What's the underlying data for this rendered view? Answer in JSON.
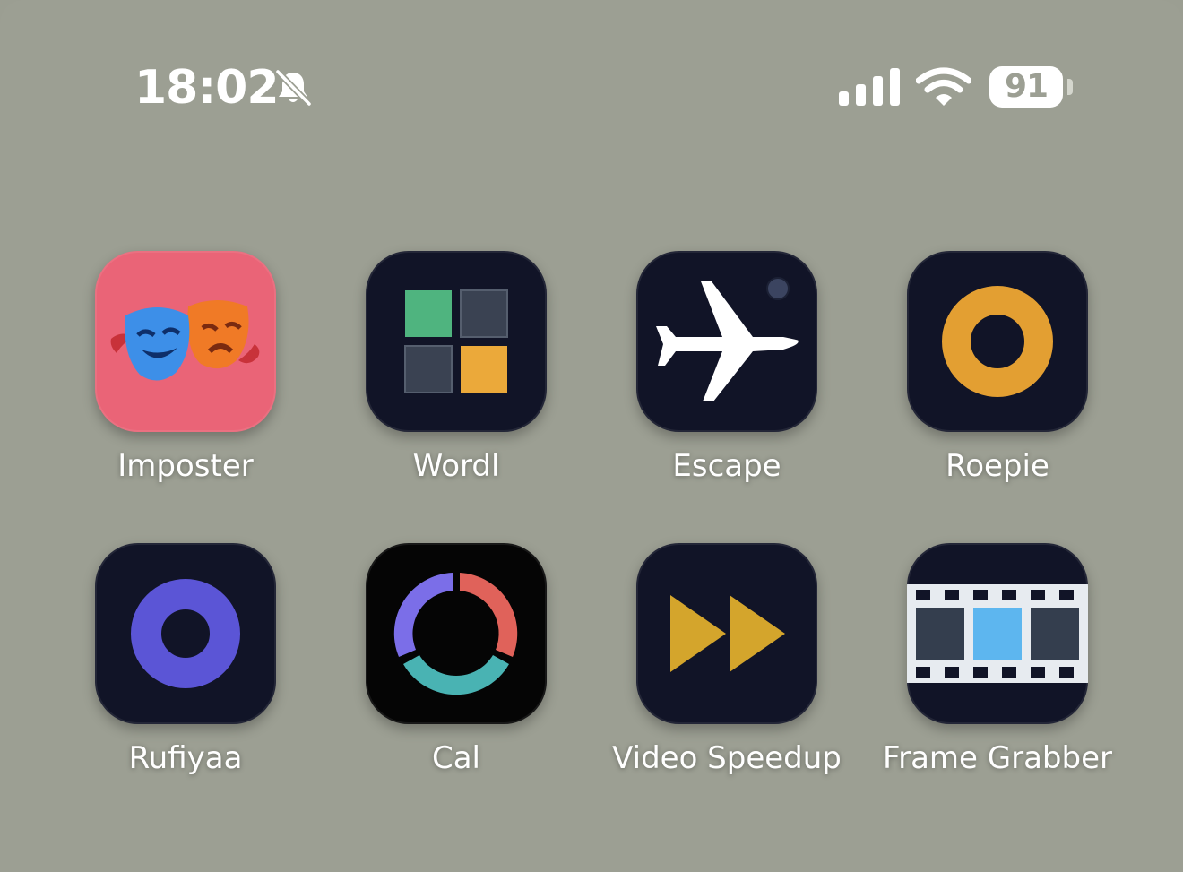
{
  "status_bar": {
    "time": "18:02",
    "silent_icon": "bell-slash-icon",
    "signal_icon": "cellular-signal-icon",
    "wifi_icon": "wifi-icon",
    "battery_level": "91"
  },
  "apps": [
    {
      "label": "Imposter",
      "icon": "theater-masks-icon",
      "color": "#ea6477"
    },
    {
      "label": "Wordl",
      "icon": "letter-grid-icon",
      "color": "#111427"
    },
    {
      "label": "Escape",
      "icon": "airplane-icon",
      "color": "#111427"
    },
    {
      "label": "Roepie",
      "icon": "orange-ring-icon",
      "color": "#111427"
    },
    {
      "label": "Rufiyaa",
      "icon": "purple-ring-icon",
      "color": "#111427"
    },
    {
      "label": "Cal",
      "icon": "donut-chart-icon",
      "color": "#050505"
    },
    {
      "label": "Video Speedup",
      "icon": "fast-forward-icon",
      "color": "#111427"
    },
    {
      "label": "Frame Grabber",
      "icon": "film-strip-icon",
      "color": "#111427"
    }
  ]
}
